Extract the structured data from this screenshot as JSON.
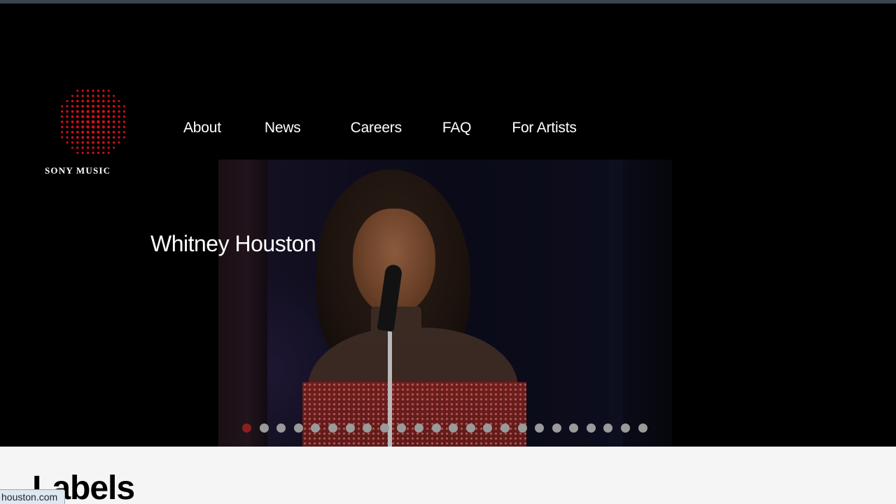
{
  "logo": {
    "brand_text": "SONY MUSIC",
    "dot_color": "#d10f19"
  },
  "nav": {
    "items": [
      "About",
      "News",
      "Careers",
      "FAQ",
      "For Artists"
    ]
  },
  "hero": {
    "artist_name": "Whitney Houston",
    "carousel": {
      "total_slides": 24,
      "active_index": 0,
      "active_color": "#8a1f1f",
      "inactive_color": "#9a9a9a"
    }
  },
  "section": {
    "heading": "Labels"
  },
  "status_bar": {
    "url_text": "houston.com"
  },
  "colors": {
    "background": "#000000",
    "text": "#ffffff",
    "section_bg": "#f5f5f5"
  }
}
